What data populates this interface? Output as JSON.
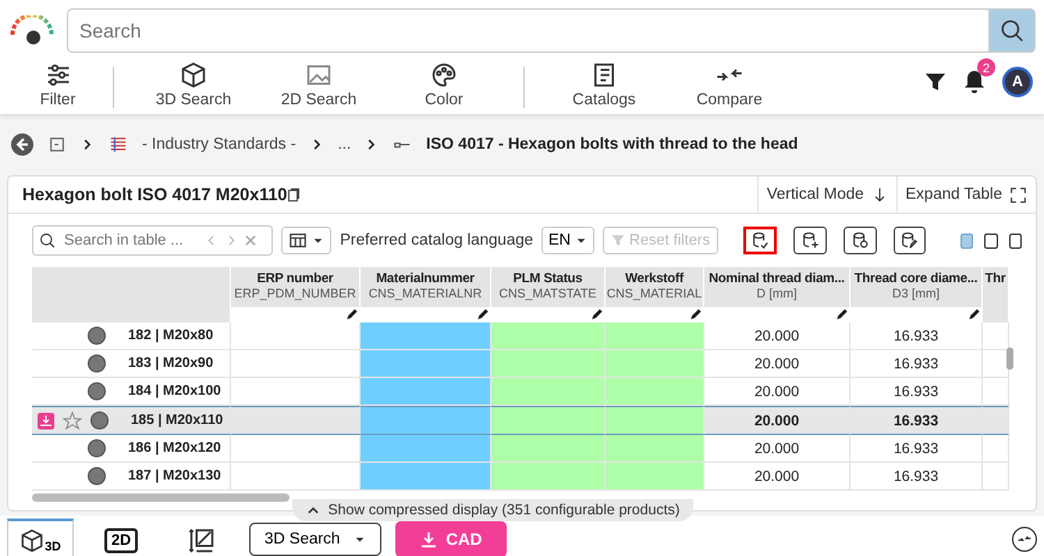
{
  "search": {
    "placeholder": "Search"
  },
  "toolbar": [
    {
      "label": "Filter",
      "kind": "filter"
    },
    {
      "label": "3D Search",
      "kind": "cube"
    },
    {
      "label": "2D Search",
      "kind": "image"
    },
    {
      "label": "Color",
      "kind": "palette"
    },
    {
      "label": "Catalogs",
      "kind": "book"
    },
    {
      "label": "Compare",
      "kind": "compare"
    }
  ],
  "notifications": {
    "count": "2"
  },
  "avatar": {
    "initial": "A"
  },
  "breadcrumb": [
    "- Industry Standards -",
    "...",
    "ISO 4017 - Hexagon bolts with thread to the head"
  ],
  "panel": {
    "title": "Hexagon bolt ISO 4017 M20x110",
    "vertical_mode": "Vertical Mode",
    "expand_table": "Expand Table"
  },
  "table_search": {
    "placeholder": "Search in table ..."
  },
  "language": {
    "label": "Preferred catalog language",
    "value": "EN"
  },
  "reset_filters": {
    "label": "Reset filters",
    "disabled": true
  },
  "action_buttons": [
    {
      "kind": "check",
      "selected": true
    },
    {
      "kind": "add",
      "selected": false
    },
    {
      "kind": "copy",
      "selected": false
    },
    {
      "kind": "edit",
      "selected": false
    }
  ],
  "view_modes": [
    {
      "selected": true
    },
    {
      "selected": false
    },
    {
      "selected": false
    }
  ],
  "columns": [
    {
      "title": "ERP number",
      "subtitle": "ERP_PDM_NUMBER"
    },
    {
      "title": "Materialnummer",
      "subtitle": "CNS_MATERIALNR",
      "color": "#6ecfff"
    },
    {
      "title": "PLM Status",
      "subtitle": "CNS_MATSTATE",
      "color": "#aeffa8"
    },
    {
      "title": "Werkstoff",
      "subtitle": "CNS_MATERIAL",
      "color": "#aeffa8"
    },
    {
      "title": "Nominal thread diam...",
      "subtitle": "D [mm]"
    },
    {
      "title": "Thread core diame...",
      "subtitle": "D3 [mm]"
    },
    {
      "title": "Thr"
    }
  ],
  "rows": [
    {
      "label": "182 | M20x80",
      "selected": false,
      "d": "20.000",
      "d3": "16.933"
    },
    {
      "label": "183 | M20x90",
      "selected": false,
      "d": "20.000",
      "d3": "16.933"
    },
    {
      "label": "184 | M20x100",
      "selected": false,
      "d": "20.000",
      "d3": "16.933"
    },
    {
      "label": "185 | M20x110",
      "selected": true,
      "d": "20.000",
      "d3": "16.933"
    },
    {
      "label": "186 | M20x120",
      "selected": false,
      "d": "20.000",
      "d3": "16.933"
    },
    {
      "label": "187 | M20x130",
      "selected": false,
      "d": "20.000",
      "d3": "16.933"
    }
  ],
  "compressed_display": "Show compressed display (351 configurable products)",
  "bottom_tabs": [
    {
      "kind": "cube",
      "label": "3D",
      "selected": true
    },
    {
      "kind": "flat",
      "label": "2D",
      "selected": false
    },
    {
      "kind": "resize",
      "selected": false
    }
  ],
  "search_mode": {
    "value": "3D Search"
  },
  "cad_button": {
    "label": "CAD"
  }
}
